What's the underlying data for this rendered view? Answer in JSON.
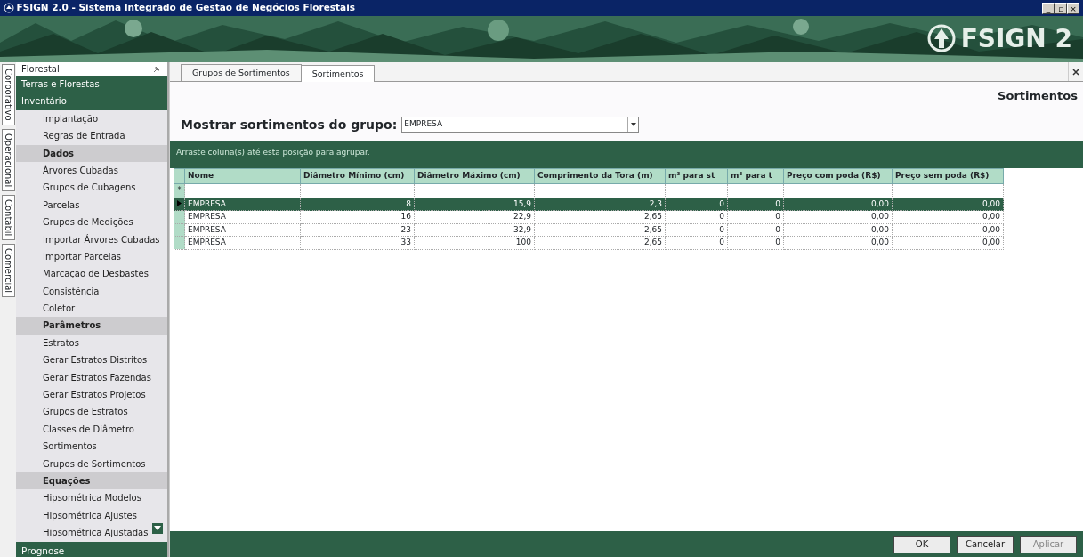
{
  "window": {
    "title": "FSIGN 2.0 - Sistema Integrado de Gestão de Negócios Florestais",
    "controls": [
      "_",
      "▫",
      "×"
    ]
  },
  "banner": {
    "logo_text": "FSIGN 2"
  },
  "side_tabs": [
    {
      "label": "Corporativo",
      "selected": false
    },
    {
      "label": "Operacional",
      "selected": false
    },
    {
      "label": "Contabil",
      "selected": false
    },
    {
      "label": "Comercial",
      "selected": false
    }
  ],
  "sidebar": {
    "title": "Florestal",
    "items": [
      {
        "kind": "section",
        "label": "Terras e Florestas"
      },
      {
        "kind": "section",
        "label": "Inventário"
      },
      {
        "kind": "item",
        "label": "Implantação"
      },
      {
        "kind": "item",
        "label": "Regras de Entrada"
      },
      {
        "kind": "group",
        "label": "Dados"
      },
      {
        "kind": "item",
        "label": "Árvores Cubadas"
      },
      {
        "kind": "item",
        "label": "Grupos de Cubagens"
      },
      {
        "kind": "item",
        "label": "Parcelas"
      },
      {
        "kind": "item",
        "label": "Grupos de Medições"
      },
      {
        "kind": "item",
        "label": "Importar Árvores Cubadas"
      },
      {
        "kind": "item",
        "label": "Importar Parcelas"
      },
      {
        "kind": "item",
        "label": "Marcação de Desbastes"
      },
      {
        "kind": "item",
        "label": "Consistência"
      },
      {
        "kind": "item",
        "label": "Coletor"
      },
      {
        "kind": "group",
        "label": "Parâmetros"
      },
      {
        "kind": "item",
        "label": "Estratos"
      },
      {
        "kind": "item",
        "label": "Gerar Estratos Distritos"
      },
      {
        "kind": "item",
        "label": "Gerar Estratos Fazendas"
      },
      {
        "kind": "item",
        "label": "Gerar Estratos Projetos"
      },
      {
        "kind": "item",
        "label": "Grupos de Estratos"
      },
      {
        "kind": "item",
        "label": "Classes de Diâmetro"
      },
      {
        "kind": "item",
        "label": "Sortimentos"
      },
      {
        "kind": "item",
        "label": "Grupos de Sortimentos"
      },
      {
        "kind": "group",
        "label": "Equações"
      },
      {
        "kind": "item",
        "label": "Hipsométrica Modelos"
      },
      {
        "kind": "item",
        "label": "Hipsométrica Ajustes"
      },
      {
        "kind": "item",
        "label": "Hipsométrica Ajustadas"
      }
    ],
    "footer": "Prognose"
  },
  "tabs": [
    {
      "label": "Grupos de Sortimentos",
      "selected": false
    },
    {
      "label": "Sortimentos",
      "selected": true
    }
  ],
  "page_title": "Sortimentos",
  "filter": {
    "label": "Mostrar sortimentos do grupo:",
    "value": "EMPRESA"
  },
  "grid": {
    "group_hint": "Arraste coluna(s) até esta posição para agrupar.",
    "new_row_marker": "*",
    "columns": [
      "Nome",
      "Diâmetro Mínimo (cm)",
      "Diâmetro Máximo (cm)",
      "Comprimento da Tora (m)",
      "m³ para st",
      "m³ para t",
      "Preço com poda (R$)",
      "Preço sem poda (R$)"
    ],
    "rows": [
      {
        "selected": true,
        "cells": [
          "EMPRESA",
          "8",
          "15,9",
          "2,3",
          "0",
          "0",
          "0,00",
          "0,00"
        ]
      },
      {
        "selected": false,
        "cells": [
          "EMPRESA",
          "16",
          "22,9",
          "2,65",
          "0",
          "0",
          "0,00",
          "0,00"
        ]
      },
      {
        "selected": false,
        "cells": [
          "EMPRESA",
          "23",
          "32,9",
          "2,65",
          "0",
          "0",
          "0,00",
          "0,00"
        ]
      },
      {
        "selected": false,
        "cells": [
          "EMPRESA",
          "33",
          "100",
          "2,65",
          "0",
          "0",
          "0,00",
          "0,00"
        ]
      }
    ]
  },
  "buttons": [
    {
      "label": "OK",
      "disabled": false
    },
    {
      "label": "Cancelar",
      "disabled": false
    },
    {
      "label": "Aplicar",
      "disabled": true
    }
  ]
}
